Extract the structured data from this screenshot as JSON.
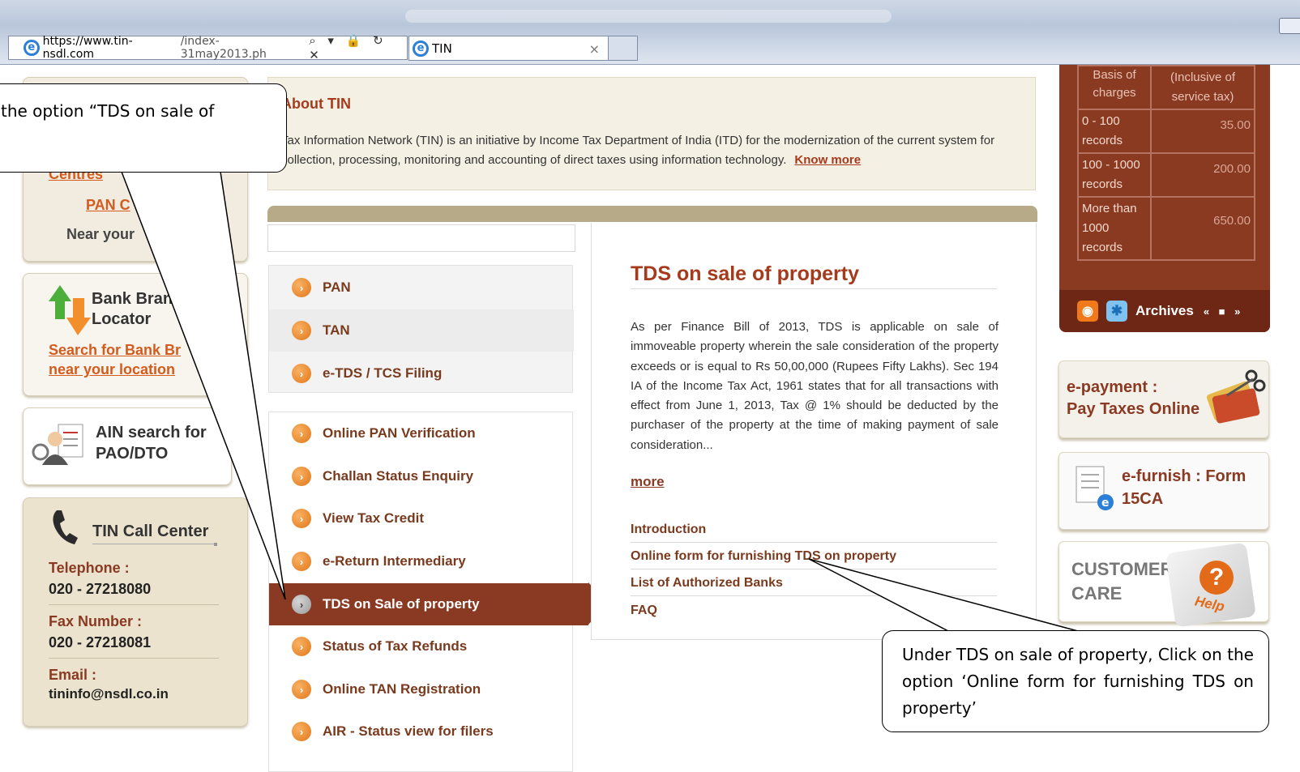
{
  "browser": {
    "url_host": "https://www.tin-nsdl.com",
    "url_rest": "/index-31may2013.ph",
    "addr_icons": "⌕ ▾ 🔒 ↻ ✕",
    "tab_title": "TIN",
    "tab_close": "×"
  },
  "left": {
    "centres_link": "Centres",
    "pan_link": "PAN C",
    "near_text": "Near your",
    "bank_title_1": "Bank Bran",
    "bank_title_2": "Locator",
    "bank_link_1": "Search for Bank Br",
    "bank_link_2": "near your location",
    "ain_title_1": "AIN search for",
    "ain_title_2": "PAO/DTO",
    "call_center_title": "TIN Call Center",
    "telephone_label": "Telephone :",
    "telephone_value": "020 - 27218080",
    "fax_label": "Fax Number :",
    "fax_value": "020 - 27218081",
    "email_label": "Email :",
    "email_value": "tininfo@nsdl.co.in"
  },
  "about": {
    "title": "About TIN",
    "text": "Tax Information Network (TIN) is an initiative by Income Tax Department of India (ITD) for the modernization of the current system for collection, processing, monitoring and accounting of direct taxes using information technology.",
    "know_more": "Know more"
  },
  "menu": {
    "group1": [
      "PAN",
      "TAN",
      "e-TDS / TCS Filing"
    ],
    "group2": [
      "Online PAN Verification",
      "Challan Status Enquiry",
      "View Tax Credit",
      "e-Return Intermediary",
      "TDS on Sale of property",
      "Status of Tax Refunds",
      "Online TAN Registration",
      "AIR - Status view for filers"
    ],
    "active": "TDS on Sale of property",
    "bullet": "›"
  },
  "content": {
    "title": "TDS on sale of property",
    "body": "As per Finance Bill of 2013, TDS is applicable on sale of immoveable property wherein the sale consideration of the property exceeds or is equal to Rs 50,00,000 (Rupees Fifty Lakhs). Sec 194 IA of the Income Tax Act, 1961 states that for all transactions with effect from June 1, 2013, Tax @ 1% should be deducted by the purchaser of the property at the time of making payment of sale consideration...",
    "more": "more",
    "links": [
      "Introduction",
      "Online form for furnishing TDS on property",
      "List of Authorized Banks",
      "FAQ"
    ]
  },
  "fees": {
    "header_1": "Basis of charges",
    "header_2": "(Inclusive of service tax)",
    "rows": [
      {
        "basis": "0 - 100 records",
        "amount": "35.00"
      },
      {
        "basis": "100 - 1000 records",
        "amount": "200.00"
      },
      {
        "basis": "More than 1000 records",
        "amount": "650.00"
      }
    ],
    "archives_label": "Archives",
    "nav_icons": "« ■ »"
  },
  "right": {
    "epayment_1": "e-payment :",
    "epayment_2": "Pay Taxes Online",
    "efurnish_1": "e-furnish : Form",
    "efurnish_2": "15CA",
    "customer_care_1": "CUSTOMER",
    "customer_care_2": "CARE",
    "help_mark": "?",
    "help_text": "Help"
  },
  "callouts": {
    "left_text": "the option “TDS on sale of",
    "right_text": "Under TDS on sale of property, Click on the option ‘Online form for furnishing TDS on property’"
  },
  "colors": {
    "brand_brown": "#8a3a22",
    "link_orange": "#d45b1d",
    "heading_red": "#a63a1c"
  }
}
